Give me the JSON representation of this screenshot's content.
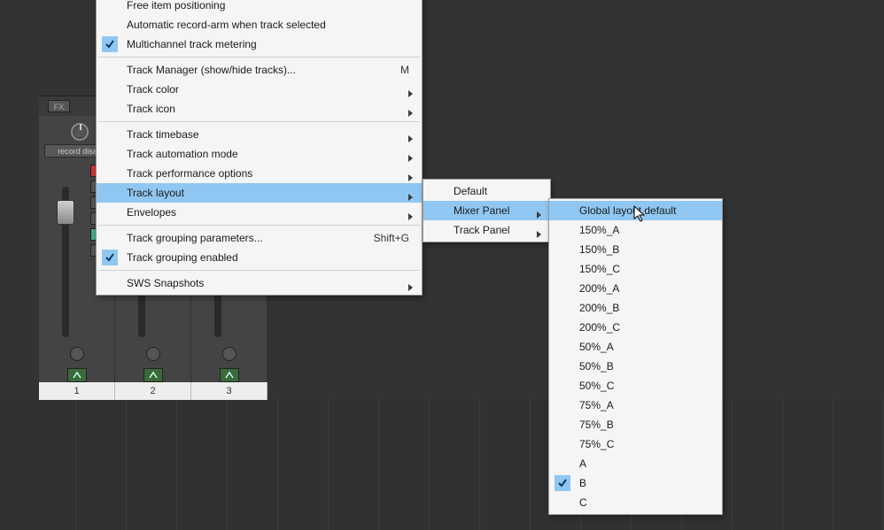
{
  "track_head": {
    "fx": "FX",
    "rec": "record disa"
  },
  "labels": [
    "1",
    "2",
    "3"
  ],
  "menu1": [
    {
      "label": "Free item positioning"
    },
    {
      "label": "Automatic record-arm when track selected"
    },
    {
      "label": "Multichannel track metering",
      "checked": true
    },
    {
      "sep": true
    },
    {
      "label": "Track Manager (show/hide tracks)...",
      "short": "M"
    },
    {
      "label": "Track color",
      "sub": true
    },
    {
      "label": "Track icon",
      "sub": true
    },
    {
      "sep": true
    },
    {
      "label": "Track timebase",
      "sub": true
    },
    {
      "label": "Track automation mode",
      "sub": true
    },
    {
      "label": "Track performance options",
      "sub": true
    },
    {
      "label": "Track layout",
      "sub": true,
      "sel": true
    },
    {
      "label": "Envelopes",
      "sub": true
    },
    {
      "sep": true
    },
    {
      "label": "Track grouping parameters...",
      "short": "Shift+G"
    },
    {
      "label": "Track grouping enabled",
      "checked": true
    },
    {
      "sep": true
    },
    {
      "label": "SWS Snapshots",
      "sub": true
    }
  ],
  "menu2": [
    {
      "label": "Default"
    },
    {
      "label": "Mixer Panel",
      "sub": true,
      "sel": true
    },
    {
      "label": "Track Panel",
      "sub": true
    }
  ],
  "menu3": [
    {
      "label": "Global layout default",
      "sel": true
    },
    {
      "label": "150%_A"
    },
    {
      "label": "150%_B"
    },
    {
      "label": "150%_C"
    },
    {
      "label": "200%_A"
    },
    {
      "label": "200%_B"
    },
    {
      "label": "200%_C"
    },
    {
      "label": "50%_A"
    },
    {
      "label": "50%_B"
    },
    {
      "label": "50%_C"
    },
    {
      "label": "75%_A"
    },
    {
      "label": "75%_B"
    },
    {
      "label": "75%_C"
    },
    {
      "label": "A"
    },
    {
      "label": "B",
      "checked": true
    },
    {
      "label": "C"
    }
  ]
}
